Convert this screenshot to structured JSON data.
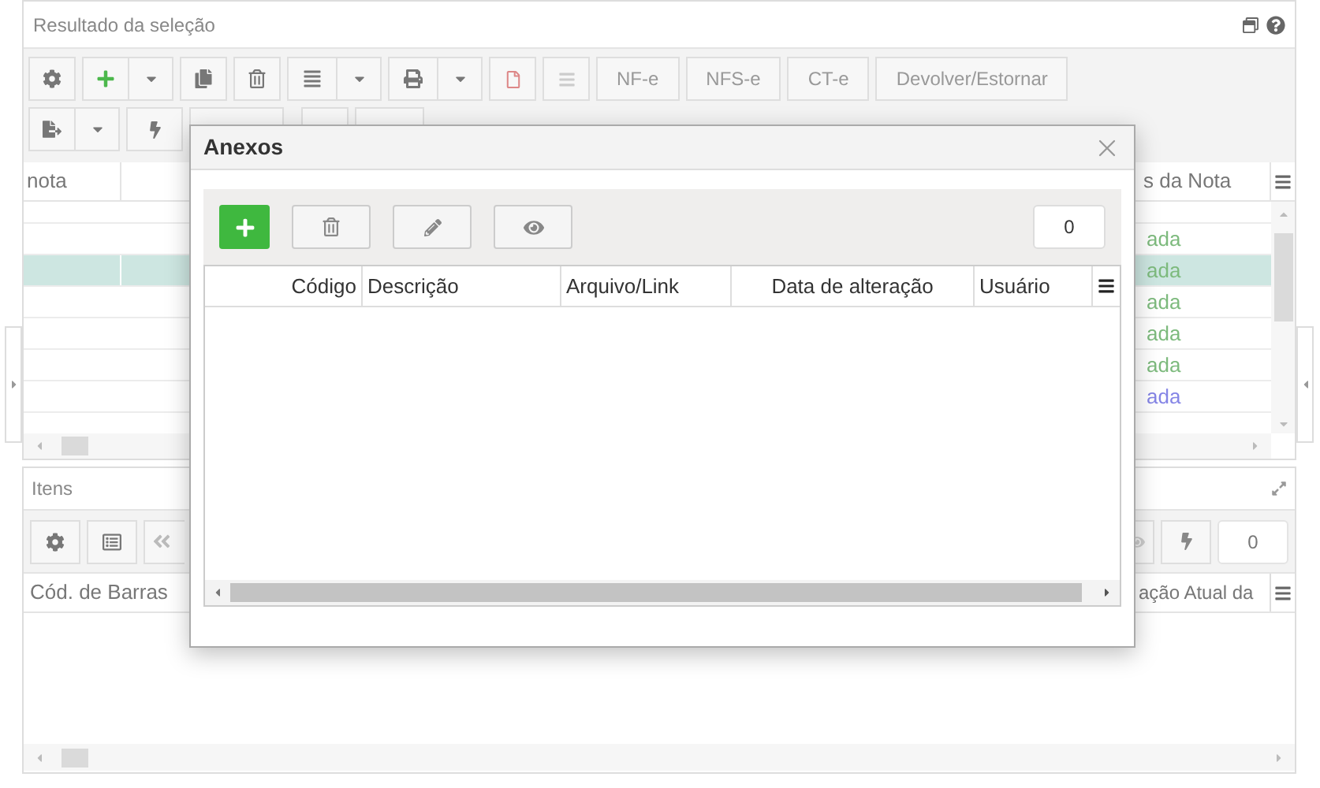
{
  "results_panel": {
    "title": "Resultado da seleção",
    "toolbar_buttons": [
      "NF-e",
      "NFS-e",
      "CT-e",
      "Devolver/Estornar"
    ],
    "columns": [
      "nota",
      "s da Nota"
    ],
    "rows": [
      {
        "selected": false
      },
      {
        "status": "ada",
        "color": "#7dba7d",
        "selected": false
      },
      {
        "status": "ada",
        "color": "#7dba7d",
        "selected": true
      },
      {
        "status": "ada",
        "color": "#7dba7d",
        "selected": false
      },
      {
        "status": "ada",
        "color": "#7dba7d",
        "selected": false
      },
      {
        "status": "ada",
        "color": "#7dba7d",
        "selected": false
      },
      {
        "status": "ada",
        "color": "#8585e6",
        "selected": false
      }
    ]
  },
  "items_panel": {
    "title": "Itens",
    "count": "0",
    "columns": [
      "Cód. de Barras",
      "ação Atual da"
    ]
  },
  "dialog": {
    "title": "Anexos",
    "count": "0",
    "columns": [
      "Código",
      "Descrição",
      "Arquivo/Link",
      "Data de alteração",
      "Usuário"
    ]
  }
}
